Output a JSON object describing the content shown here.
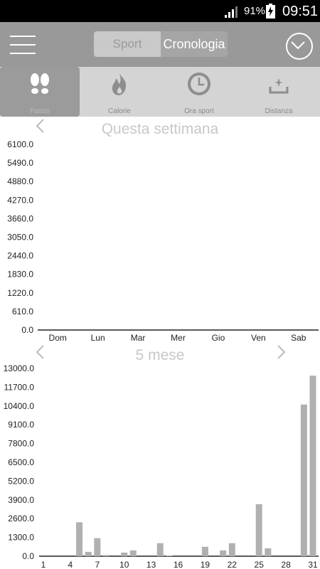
{
  "status": {
    "battery": "91%",
    "time": "09:51"
  },
  "header": {
    "tabs": [
      {
        "label": "Sport",
        "active": false
      },
      {
        "label": "Cronologia",
        "active": true
      }
    ]
  },
  "metrics": [
    {
      "label": "Passo",
      "icon": "footprints-icon",
      "active": true
    },
    {
      "label": "Calorie",
      "icon": "flame-icon",
      "active": false
    },
    {
      "label": "Ora sport",
      "icon": "clock-icon",
      "active": false
    },
    {
      "label": "Distanza",
      "icon": "distance-icon",
      "active": false
    }
  ],
  "week": {
    "title": "Questa settimana"
  },
  "month": {
    "title": "5 mese"
  },
  "chart_data": [
    {
      "type": "bar",
      "categories": [
        "Dom",
        "Lun",
        "Mar",
        "Mer",
        "Gio",
        "Ven",
        "Sab"
      ],
      "values": [
        0,
        0,
        0,
        0,
        0,
        0,
        0
      ],
      "yticks": [
        "0.0",
        "610.0",
        "1220.0",
        "1830.0",
        "2440.0",
        "3050.0",
        "3660.0",
        "4270.0",
        "4880.0",
        "5490.0",
        "6100.0"
      ],
      "ylim": [
        0,
        6100
      ],
      "grid": false
    },
    {
      "type": "bar",
      "x": [
        1,
        2,
        3,
        4,
        5,
        6,
        7,
        8,
        9,
        10,
        11,
        12,
        13,
        14,
        15,
        16,
        17,
        18,
        19,
        20,
        21,
        22,
        23,
        24,
        25,
        26,
        27,
        28,
        29,
        30,
        31
      ],
      "xticks": [
        "1",
        "4",
        "7",
        "10",
        "13",
        "16",
        "19",
        "22",
        "25",
        "28",
        "31"
      ],
      "values": [
        0,
        0,
        0,
        0,
        2350,
        300,
        1250,
        80,
        0,
        250,
        400,
        0,
        0,
        900,
        50,
        0,
        0,
        0,
        650,
        0,
        400,
        900,
        0,
        0,
        3600,
        550,
        0,
        0,
        0,
        10500,
        12500
      ],
      "yticks": [
        "0.0",
        "1300.0",
        "2600.0",
        "3900.0",
        "5200.0",
        "6500.0",
        "7800.0",
        "9100.0",
        "10400.0",
        "11700.0",
        "13000.0"
      ],
      "ylim": [
        0,
        13000
      ],
      "grid": false,
      "bar_color": "#b0b0b0"
    }
  ]
}
